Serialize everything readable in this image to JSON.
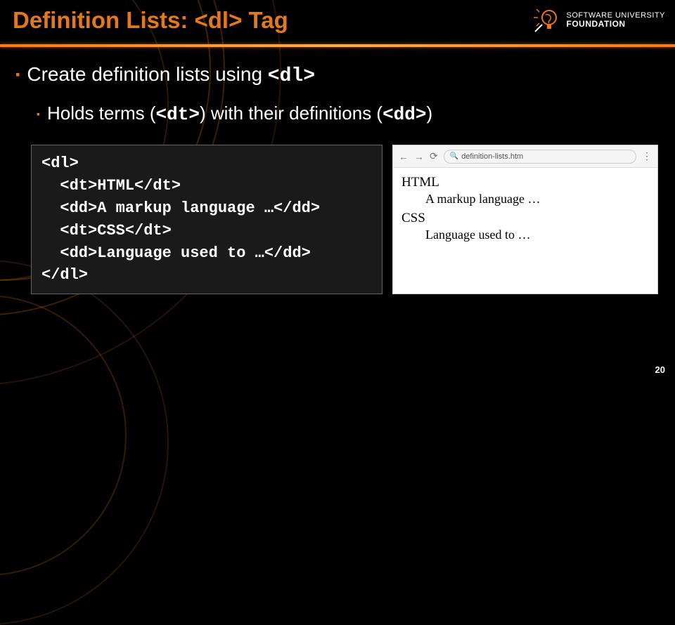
{
  "colors": {
    "accent": "#e67817"
  },
  "title": "Definition Lists: <dl> Tag",
  "logo": {
    "line1": "SOFTWARE UNIVERSITY",
    "line2": "FOUNDATION"
  },
  "bullets": {
    "l1_pre": "Create definition lists using ",
    "l1_code": "<dl>",
    "l2_pre": "Holds terms (",
    "l2_code1": "<dt>",
    "l2_mid": ") with their definitions (",
    "l2_code2": "<dd>",
    "l2_post": ")"
  },
  "code": "<dl>\n  <dt>HTML</dt>\n  <dd>A markup language …</dd>\n  <dt>CSS</dt>\n  <dd>Language used to …</dd>\n</dl>",
  "browser": {
    "address": "definition-lists.htm",
    "dt1": "HTML",
    "dd1": "A markup language …",
    "dt2": "CSS",
    "dd2": "Language used to …"
  },
  "page_number": "20"
}
